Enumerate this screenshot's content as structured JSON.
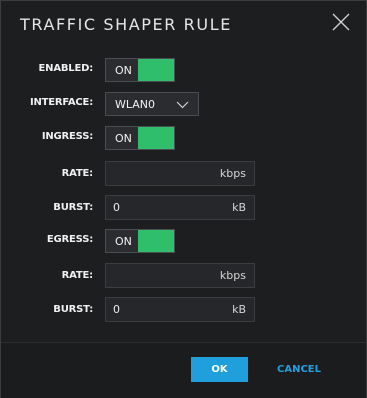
{
  "dialog": {
    "title": "TRAFFIC SHAPER RULE",
    "close_icon": "close-icon"
  },
  "form": {
    "enabled": {
      "label": "ENABLED:",
      "state": "ON",
      "on": true
    },
    "interface": {
      "label": "INTERFACE:",
      "value": "WLAN0",
      "icon": "chevron-down-icon"
    },
    "ingress": {
      "label": "INGRESS:",
      "state": "ON",
      "on": true
    },
    "ingress_rate": {
      "label": "RATE:",
      "value": "",
      "unit": "kbps"
    },
    "ingress_burst": {
      "label": "BURST:",
      "value": "0",
      "unit": "kB"
    },
    "egress": {
      "label": "EGRESS:",
      "state": "ON",
      "on": true
    },
    "egress_rate": {
      "label": "RATE:",
      "value": "",
      "unit": "kbps"
    },
    "egress_burst": {
      "label": "BURST:",
      "value": "0",
      "unit": "kB"
    }
  },
  "footer": {
    "ok_label": "OK",
    "cancel_label": "CANCEL"
  },
  "colors": {
    "background": "#1d1e20",
    "toggle_on": "#2fbf6b",
    "accent": "#1fa0dc"
  }
}
